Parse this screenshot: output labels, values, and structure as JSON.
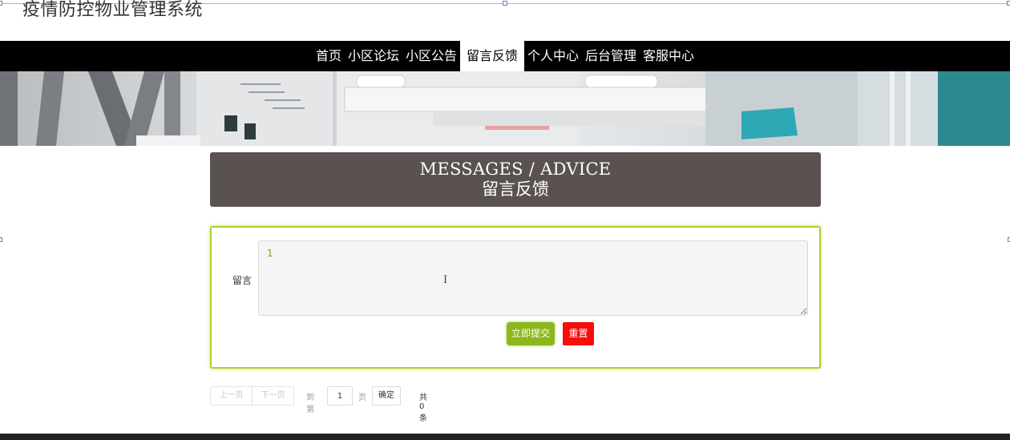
{
  "site": {
    "title": "疫情防控物业管理系统"
  },
  "nav": {
    "items": [
      {
        "label": "首页"
      },
      {
        "label": "小区论坛"
      },
      {
        "label": "小区公告"
      },
      {
        "label": "留言反馈",
        "active": true
      },
      {
        "label": "个人中心"
      },
      {
        "label": "后台管理"
      },
      {
        "label": "客服中心"
      }
    ]
  },
  "section": {
    "title_en": "MESSAGES / ADVICE",
    "title_cn": "留言反馈"
  },
  "form": {
    "label": "留言",
    "value": "1",
    "submit_label": "立即提交",
    "reset_label": "重置"
  },
  "pager": {
    "prev_label": "上一页",
    "next_label": "下一页",
    "goto_label": "到第",
    "page_value": "1",
    "page_unit": "页",
    "confirm_label": "确定",
    "total_text": "共 0 条"
  },
  "colors": {
    "nav_bg": "#000000",
    "heading_bg": "#5a5250",
    "accent_green": "#8db81d",
    "reset_red": "#f60d0d"
  }
}
